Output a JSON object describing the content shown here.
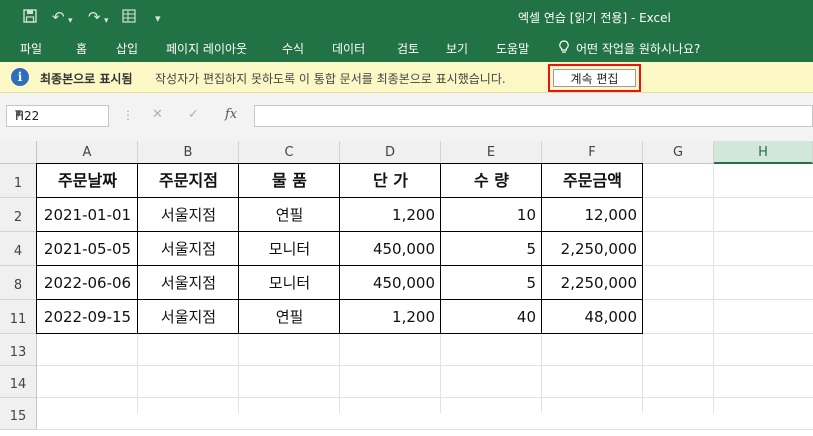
{
  "titlebar": {
    "title": "엑셀 연습  [읽기 전용]  -  Excel",
    "quick_access": [
      "save-icon",
      "undo-icon",
      "redo-icon",
      "form-icon",
      "customize-icon"
    ]
  },
  "ribbon": {
    "tabs": [
      "파일",
      "홈",
      "삽입",
      "페이지 레이아웃",
      "수식",
      "데이터",
      "검토",
      "보기",
      "도움말"
    ],
    "tell_me": "어떤 작업을 원하시나요?"
  },
  "message_bar": {
    "title": "최종본으로 표시됨",
    "text": "작성자가 편집하지 못하도록 이 통합 문서를 최종본으로 표시했습니다.",
    "button": "계속 편집"
  },
  "formula_bar": {
    "name_box": "H22",
    "fx": "fx",
    "formula": ""
  },
  "sheet": {
    "columns": [
      "A",
      "B",
      "C",
      "D",
      "E",
      "F",
      "G",
      "H"
    ],
    "selected_column": "H",
    "row_numbers": [
      "1",
      "2",
      "4",
      "8",
      "11",
      "13",
      "14",
      "15"
    ],
    "header_row": [
      "주문날짜",
      "주문지점",
      "물 품",
      "단 가",
      "수 량",
      "주문금액"
    ],
    "rows": [
      [
        "2021-01-01",
        "서울지점",
        "연필",
        "1,200",
        "10",
        "12,000"
      ],
      [
        "2021-05-05",
        "서울지점",
        "모니터",
        "450,000",
        "5",
        "2,250,000"
      ],
      [
        "2022-06-06",
        "서울지점",
        "모니터",
        "450,000",
        "5",
        "2,250,000"
      ],
      [
        "2022-09-15",
        "서울지점",
        "연필",
        "1,200",
        "40",
        "48,000"
      ]
    ]
  },
  "colors": {
    "excel_green": "#217346",
    "message_bar_bg": "#fcf8c5",
    "highlight_red": "#e11111"
  }
}
